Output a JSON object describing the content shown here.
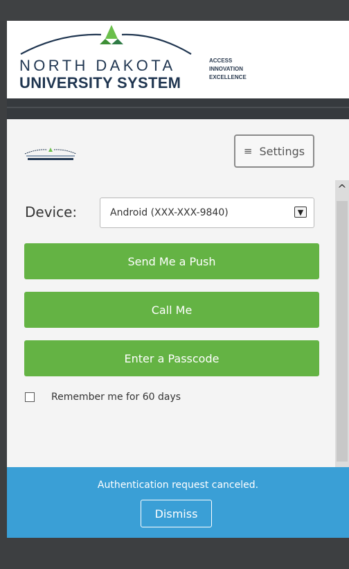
{
  "header": {
    "logo_line1": "NORTH DAKOTA",
    "logo_line2": "UNIVERSITY SYSTEM",
    "tagline": [
      "ACCESS",
      "INNOVATION",
      "EXCELLENCE"
    ]
  },
  "toolbar": {
    "settings_label": "Settings"
  },
  "form": {
    "device_label": "Device:",
    "device_selected": "Android (XXX-XXX-9840)",
    "push_label": "Send Me a Push",
    "call_label": "Call Me",
    "passcode_label": "Enter a Passcode",
    "remember_label": "Remember me for 60 days"
  },
  "notice": {
    "message": "Authentication request canceled.",
    "dismiss_label": "Dismiss"
  },
  "colors": {
    "brand_navy": "#1f3550",
    "brand_green": "#6abf4b",
    "action_green": "#64b344",
    "notice_blue": "#3a9fd6"
  }
}
